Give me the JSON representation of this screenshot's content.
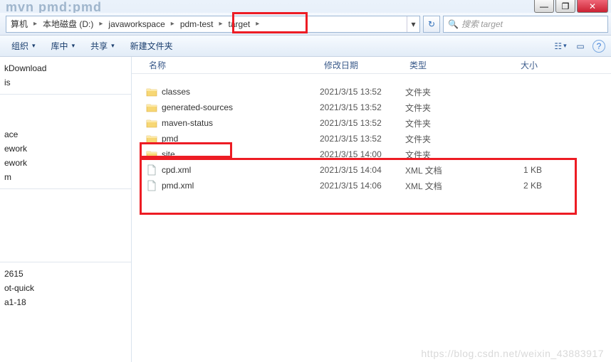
{
  "window": {
    "faded_title": "mvn pmd:pmd",
    "min": "—",
    "max": "❐",
    "close": "✕"
  },
  "breadcrumb": {
    "items": [
      "算机",
      "本地磁盘 (D:)",
      "javaworkspace",
      "pdm-test",
      "target"
    ],
    "dropdown": "▾"
  },
  "refresh": "↻",
  "search": {
    "icon": "🔍",
    "placeholder": "搜索 target"
  },
  "toolbar": {
    "organize": "组织",
    "menu1": "库中",
    "share": "共享",
    "new_folder": "新建文件夹",
    "view": "☷",
    "preview": "▭",
    "help": "?"
  },
  "sidebar": {
    "groupA": [
      "kDownload",
      "is"
    ],
    "groupB": [
      "ace",
      "ework",
      "ework",
      "m"
    ],
    "groupC": [
      "2615",
      "ot-quick",
      "a1-18"
    ]
  },
  "columns": {
    "name": "名称",
    "date": "修改日期",
    "type": "类型",
    "size": "大小"
  },
  "files": [
    {
      "icon": "folder",
      "name": "classes",
      "date": "2021/3/15 13:52",
      "type": "文件夹",
      "size": ""
    },
    {
      "icon": "folder",
      "name": "generated-sources",
      "date": "2021/3/15 13:52",
      "type": "文件夹",
      "size": ""
    },
    {
      "icon": "folder",
      "name": "maven-status",
      "date": "2021/3/15 13:52",
      "type": "文件夹",
      "size": ""
    },
    {
      "icon": "folder",
      "name": "pmd",
      "date": "2021/3/15 13:52",
      "type": "文件夹",
      "size": ""
    },
    {
      "icon": "folder",
      "name": "site",
      "date": "2021/3/15 14:00",
      "type": "文件夹",
      "size": ""
    },
    {
      "icon": "file",
      "name": "cpd.xml",
      "date": "2021/3/15 14:04",
      "type": "XML 文档",
      "size": "1 KB"
    },
    {
      "icon": "file",
      "name": "pmd.xml",
      "date": "2021/3/15 14:06",
      "type": "XML 文档",
      "size": "2 KB"
    }
  ],
  "watermark": "https://blog.csdn.net/weixin_43883917"
}
